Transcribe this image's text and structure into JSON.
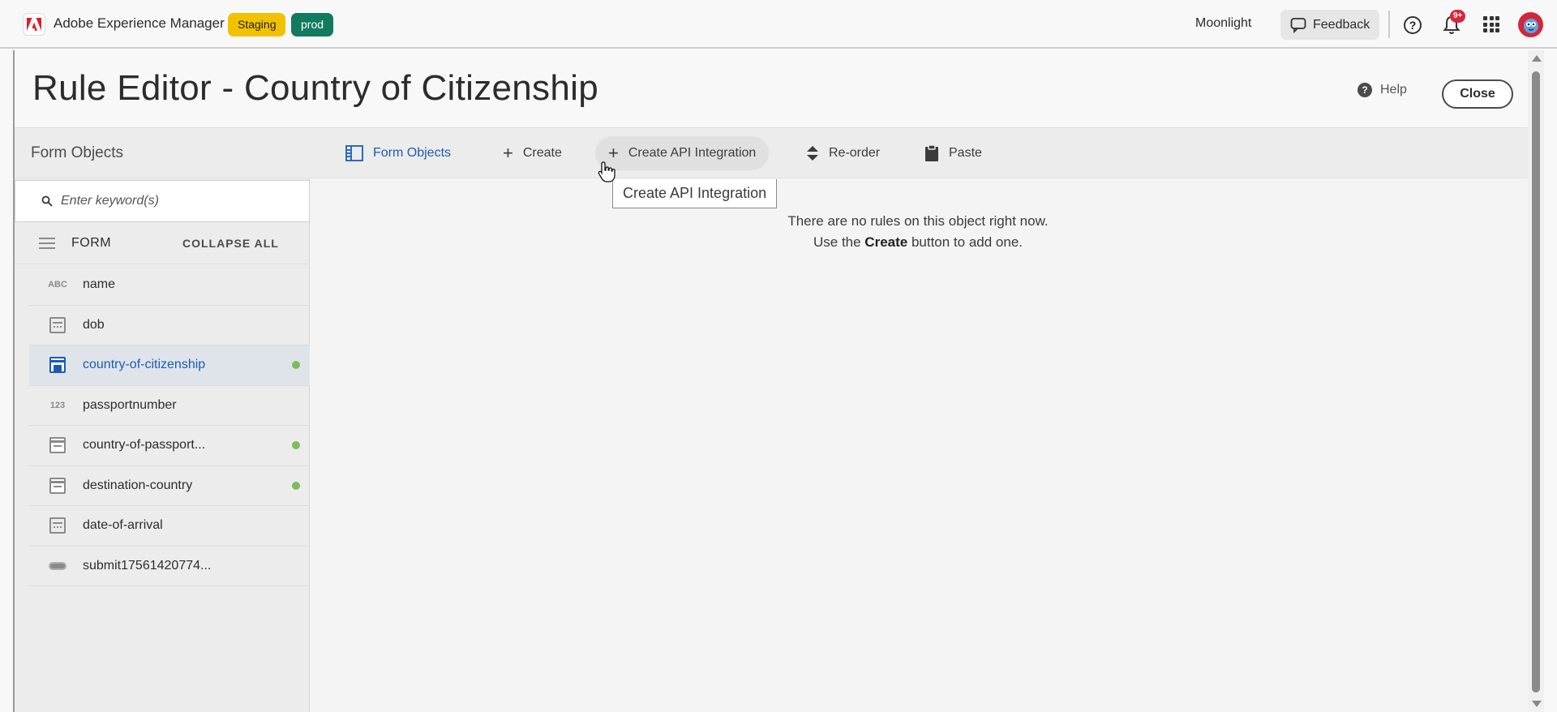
{
  "topbar": {
    "app_title": "Adobe Experience Manager",
    "badge_staging": "Staging",
    "badge_prod": "prod",
    "org_name": "Moonlight",
    "feedback_label": "Feedback",
    "notification_count": "9+"
  },
  "dialog": {
    "title": "Rule Editor - Country of Citizenship",
    "help_label": "Help",
    "close_label": "Close"
  },
  "toolbar": {
    "panel_title": "Form Objects",
    "tools": [
      {
        "label": "Form Objects",
        "icon": "form-objects-icon"
      },
      {
        "label": "Create",
        "icon": "plus-icon"
      },
      {
        "label": "Create API Integration",
        "icon": "plus-icon"
      },
      {
        "label": "Re-order",
        "icon": "reorder-icon"
      },
      {
        "label": "Paste",
        "icon": "clipboard-icon"
      }
    ],
    "tooltip": "Create API Integration"
  },
  "left_panel": {
    "search_placeholder": "Enter keyword(s)",
    "tree_root": "FORM",
    "collapse_all": "COLLAPSE ALL",
    "items": [
      {
        "label": "name",
        "type_icon": "ABC",
        "has_rule": false
      },
      {
        "label": "dob",
        "type_icon": "calendar-icon",
        "has_rule": false
      },
      {
        "label": "country-of-citizenship",
        "type_icon": "dropdown-icon",
        "has_rule": true,
        "selected": true
      },
      {
        "label": "passportnumber",
        "type_icon": "123",
        "has_rule": false
      },
      {
        "label": "country-of-passport...",
        "type_icon": "dropdown-icon",
        "has_rule": true
      },
      {
        "label": "destination-country",
        "type_icon": "dropdown-icon",
        "has_rule": true
      },
      {
        "label": "date-of-arrival",
        "type_icon": "calendar-icon",
        "has_rule": false
      },
      {
        "label": "submit17561420774...",
        "type_icon": "button-icon",
        "has_rule": false
      }
    ]
  },
  "main": {
    "empty_line1": "There are no rules on this object right now.",
    "empty_line2_prefix": "Use the ",
    "empty_line2_bold": "Create",
    "empty_line2_suffix": " button to add one."
  },
  "colors": {
    "accent_blue": "#1c5bb5",
    "staging": "#f2c200",
    "prod": "#127a5f",
    "rule_dot": "#7cbd5c",
    "notification": "#d7263d"
  }
}
